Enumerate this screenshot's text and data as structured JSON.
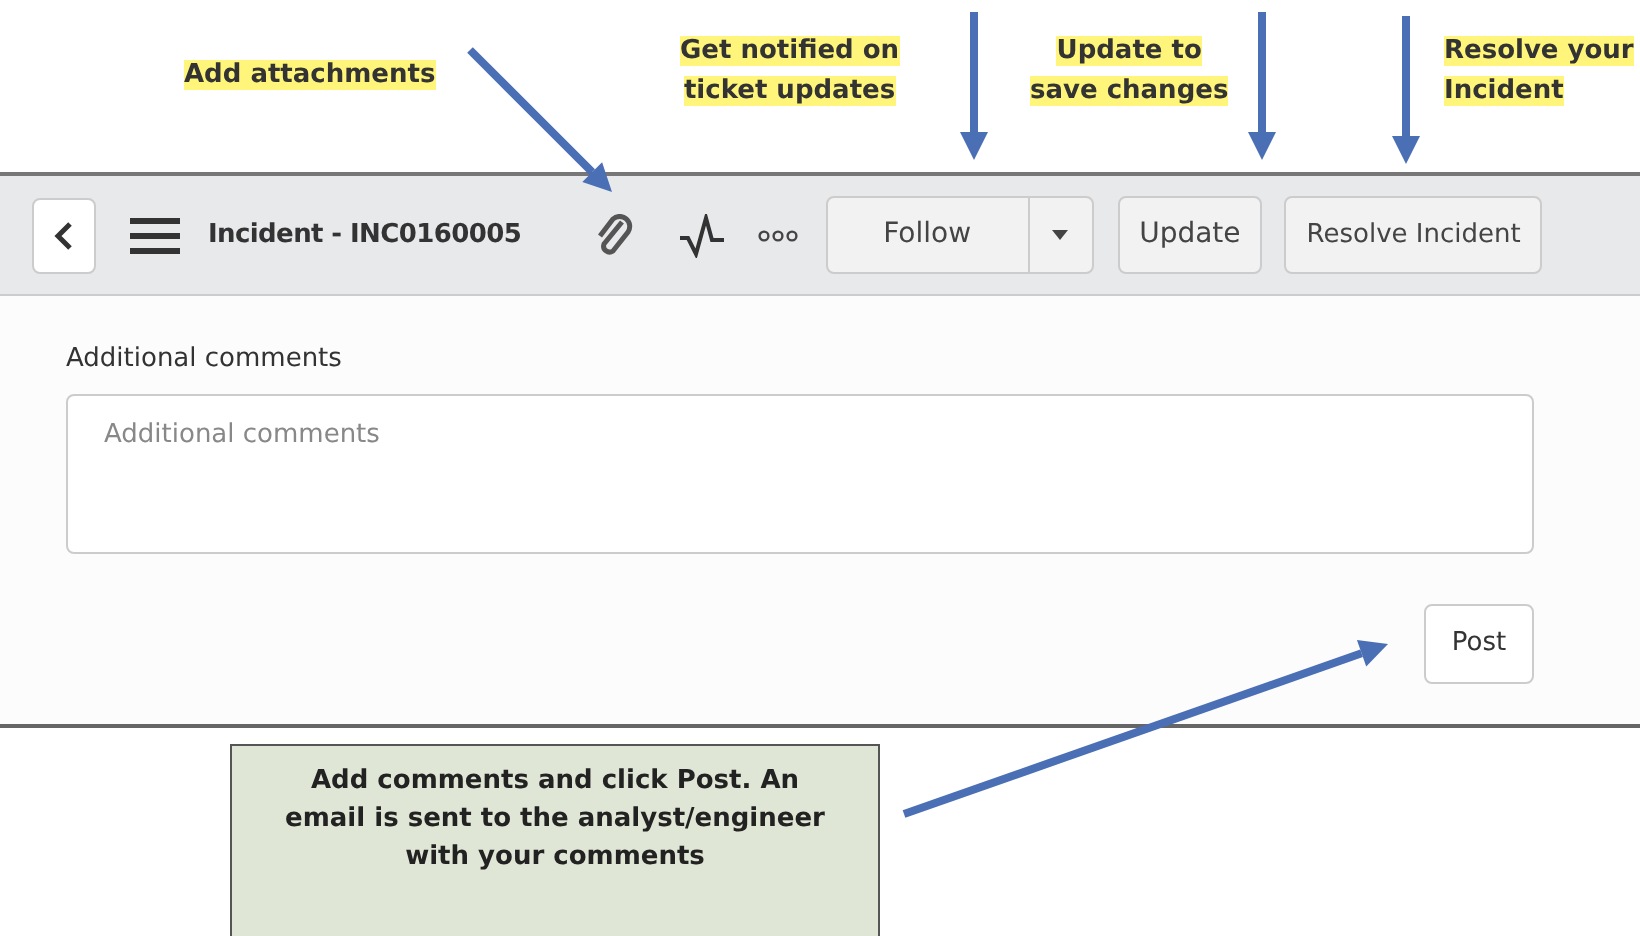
{
  "toolbar": {
    "title": "Incident - INC0160005",
    "follow_button": "Follow",
    "update_button": "Update",
    "resolve_button": "Resolve Incident"
  },
  "form": {
    "label": "Additional comments",
    "comment_field": {
      "placeholder": "Additional comments"
    },
    "post_button": "Post"
  },
  "annotations": [
    {
      "lines": [
        "Add attachments"
      ]
    },
    {
      "lines": [
        "Get notified on",
        "ticket updates"
      ]
    },
    {
      "lines": [
        "Update to",
        "save changes"
      ]
    },
    {
      "lines": [
        "Resolve your",
        "Incident"
      ]
    }
  ],
  "callout": {
    "text": "Add comments and click Post.  An email is sent to the analyst/engineer with your comments"
  }
}
